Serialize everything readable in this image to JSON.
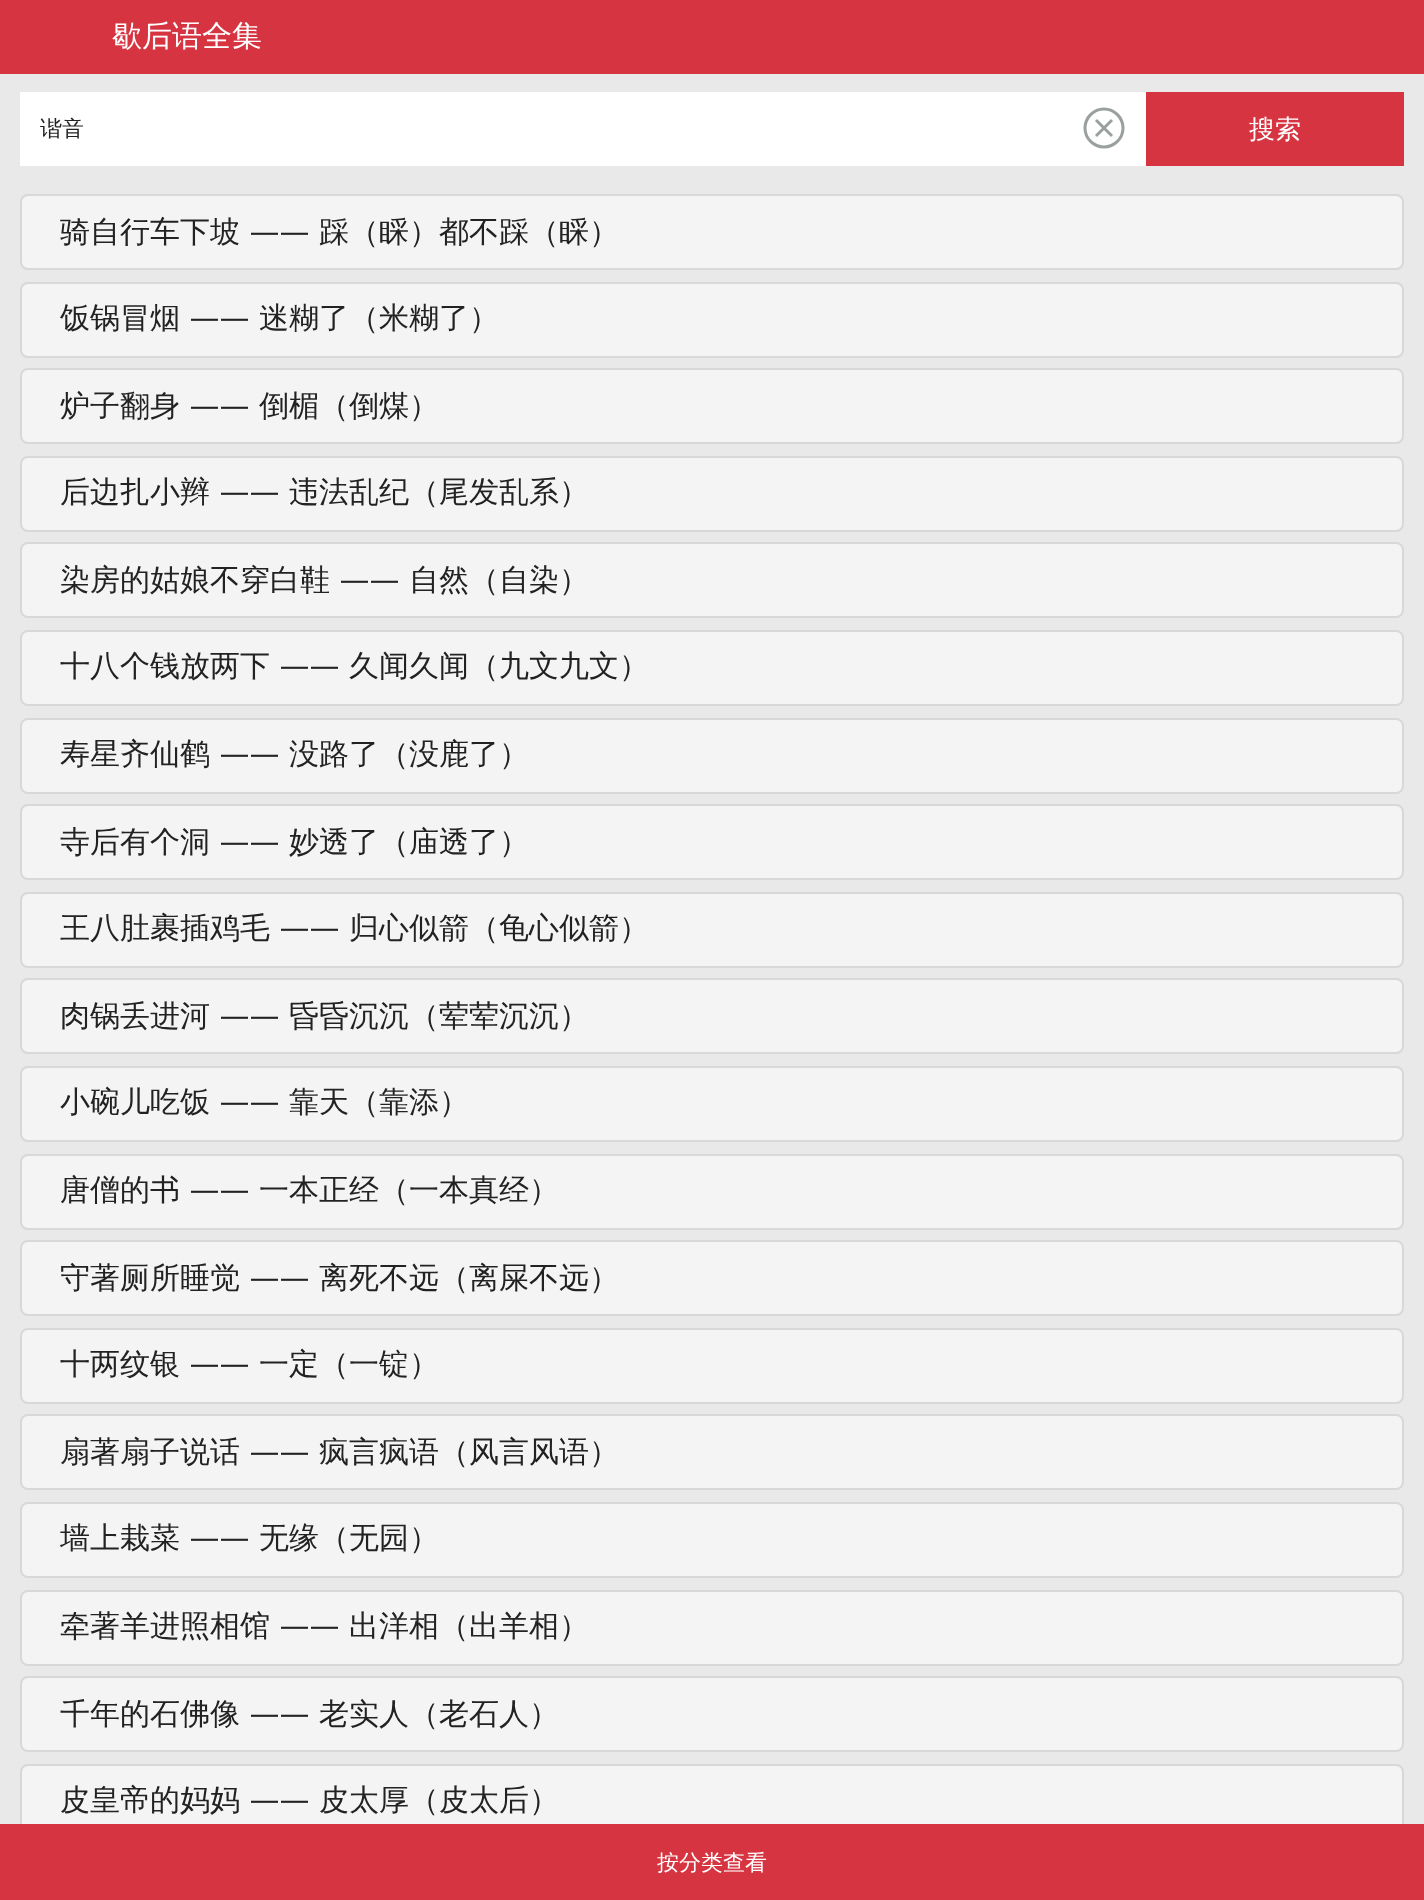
{
  "header": {
    "title": "歇后语全集"
  },
  "search": {
    "value": "谐音",
    "button": "搜索"
  },
  "items": [
    "骑自行车下坡 —— 踩（睬）都不踩（睬）",
    "饭锅冒烟 —— 迷糊了（米糊了）",
    "炉子翻身 —— 倒楣（倒煤）",
    "后边扎小辫 —— 违法乱纪（尾发乱系）",
    "染房的姑娘不穿白鞋 —— 自然（自染）",
    "十八个钱放两下 —— 久闻久闻（九文九文）",
    "寿星齐仙鹤 —— 没路了（没鹿了）",
    "寺后有个洞 —— 妙透了（庙透了）",
    "王八肚裹插鸡毛 —— 归心似箭（龟心似箭）",
    "肉锅丢进河 —— 昏昏沉沉（荤荤沉沉）",
    "小碗儿吃饭 —— 靠天（靠添）",
    "唐僧的书 —— 一本正经（一本真经）",
    "守著厕所睡觉 —— 离死不远（离屎不远）",
    "十两纹银 —— 一定（一锭）",
    "扇著扇子说话 —— 疯言疯语（风言风语）",
    "墙上栽菜 —— 无缘（无园）",
    "牵著羊进照相馆 —— 出洋相（出羊相）",
    "千年的石佛像 —— 老实人（老石人）",
    "皮皇帝的妈妈 —— 皮太厚（皮太后）"
  ],
  "bottom_button": "按分类查看"
}
